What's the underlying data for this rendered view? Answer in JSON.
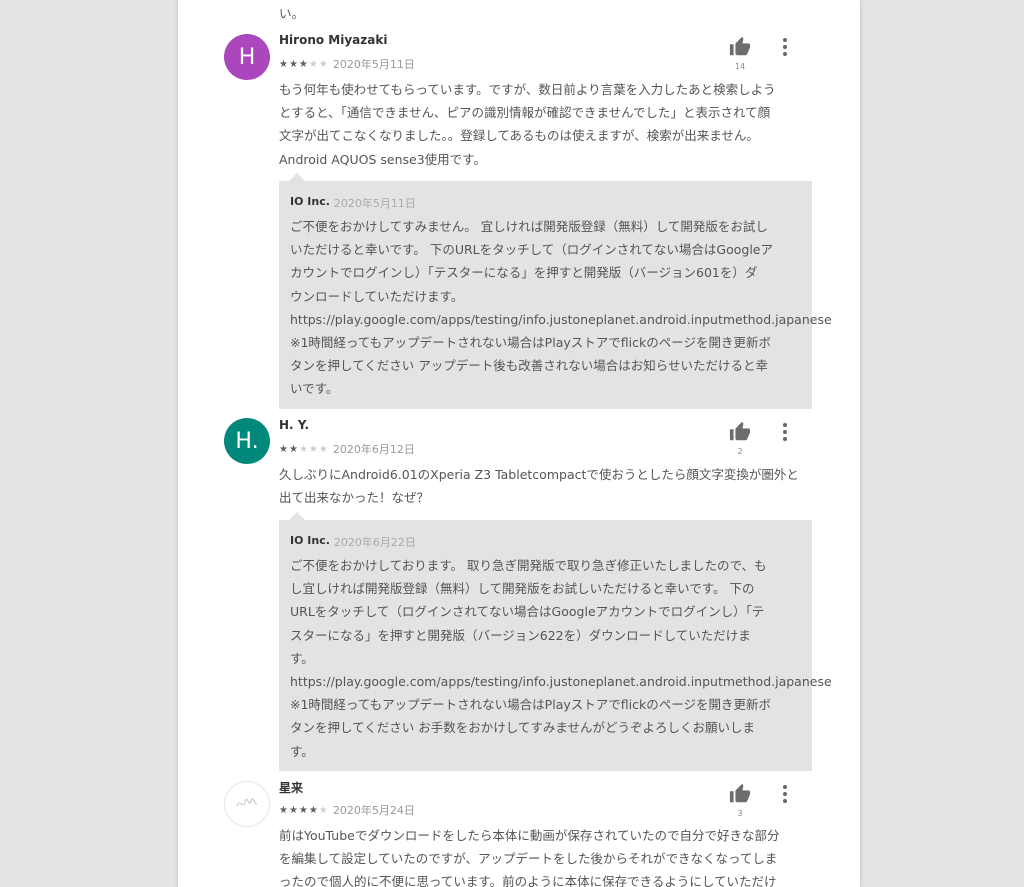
{
  "top_fragment": "い。",
  "reviews": [
    {
      "initial": "H",
      "avatar_color": "#ab47bc",
      "name": "Hirono Miyazaki",
      "date": "2020年5月11日",
      "rating": 3,
      "likes": "14",
      "text": "もう何年も使わせてもらっています。ですが、数日前より言葉を入力したあと検索しよう\nとすると、「通信できません、ピアの識別情報が確認できませんでした」と表示されて顔\n文字が出てこなくなりました。。登録してあるものは使えますが、検索が出来ません。\nAndroid AQUOS sense3使用です。",
      "reply": {
        "developer": "IO Inc.",
        "date": "2020年5月11日",
        "text": "ご不便をおかけしてすみません。 宜しければ開発版登録（無料）して開発版をお試し\nいただけると幸いです。 下のURLをタッチして（ログインされてない場合はGoogleア\nカウントでログインし）「テスターになる」を押すと開発版（バージョン601を）ダ\nウンロードしていただけます。\nhttps://play.google.com/apps/testing/info.justoneplanet.android.inputmethod.japanese\n※1時間経ってもアップデートされない場合はPlayストアでflickのページを開き更新ボ\nタンを押してください アップデート後も改善されない場合はお知らせいただけると幸\nいです。"
      }
    },
    {
      "initial": "H.",
      "avatar_color": "#00897b",
      "name": "H. Y.",
      "date": "2020年6月12日",
      "rating": 2,
      "likes": "2",
      "text": "久しぶりにAndroid6.01のXperia Z3 Tabletcompactで使おうとしたら顔文字変換が圏外と\n出て出来なかった！なぜ？",
      "reply": {
        "developer": "IO Inc.",
        "date": "2020年6月22日",
        "text": "ご不便をおかけしております。 取り急ぎ開発版で取り急ぎ修正いたしましたので、も\nし宜しければ開発版登録（無料）して開発版をお試しいただけると幸いです。 下の\nURLをタッチして（ログインされてない場合はGoogleアカウントでログインし）「テ\nスターになる」を押すと開発版（バージョン622を）ダウンロードしていただけま\nす。\nhttps://play.google.com/apps/testing/info.justoneplanet.android.inputmethod.japanese\n※1時間経ってもアップデートされない場合はPlayストアでflickのページを開き更新ボ\nタンを押してください お手数をおかけしてすみませんがどうぞよろしくお願いしま\nす。"
      }
    },
    {
      "initial": "",
      "avatar_color": "#ffffff",
      "name": "星来",
      "date": "2020年5月24日",
      "rating": 4,
      "likes": "3",
      "text": "前はYouTubeでダウンロードをしたら本体に動画が保存されていたので自分で好きな部分\nを編集して設定していたのですが、アップデートをした後からそれができなくなってしま\nったので個人的に不便に思っています。前のように本体に保存できるようにしていただけ"
    }
  ]
}
